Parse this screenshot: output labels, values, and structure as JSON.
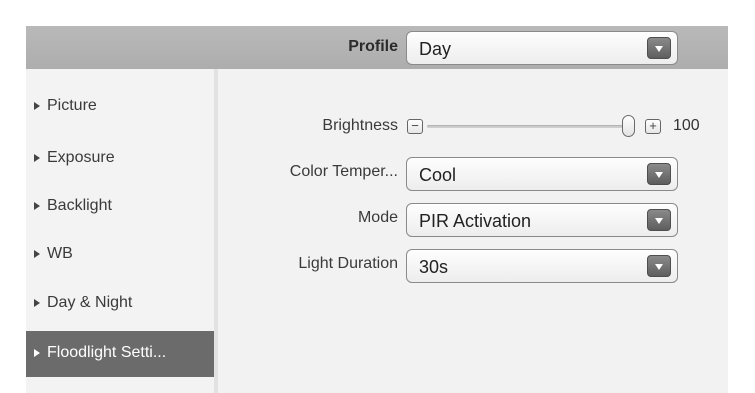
{
  "profile": {
    "label": "Profile",
    "value": "Day"
  },
  "sidebar": {
    "items": [
      {
        "label": "Picture",
        "active": false
      },
      {
        "label": "Exposure",
        "active": false
      },
      {
        "label": "Backlight",
        "active": false
      },
      {
        "label": "WB",
        "active": false
      },
      {
        "label": "Day & Night",
        "active": false
      },
      {
        "label": "Floodlight Setti...",
        "active": true
      }
    ]
  },
  "settings": {
    "brightness": {
      "label": "Brightness",
      "decrement_symbol": "−",
      "increment_symbol": "+",
      "value": 100,
      "value_text": "100"
    },
    "color_temperature": {
      "label": "Color Temper...",
      "value": "Cool"
    },
    "mode": {
      "label": "Mode",
      "value": "PIR Activation"
    },
    "light_duration": {
      "label": "Light Duration",
      "value": "30s"
    }
  },
  "colors": {
    "header_bar": "#b3b3b3",
    "active_item": "#6b6b6b",
    "panel_background": "#f2f2f2"
  }
}
